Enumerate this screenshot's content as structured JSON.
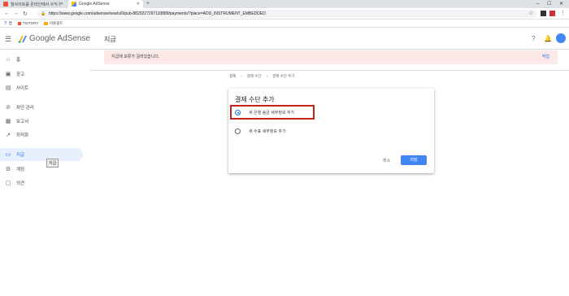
{
  "browser": {
    "tabs": [
      {
        "title": "월사이트를 온라인에서 수익 찬",
        "active": false
      },
      {
        "title": "Google AdSense",
        "active": true
      }
    ],
    "url": "https://www.google.com/adsense/new/u/0/pub-8820227297110889/payments/?place=ADD_INSTRUMENT_EMBEDDED",
    "bookmarks": [
      "앱",
      "TISTORY",
      "이튜링드"
    ]
  },
  "app": {
    "brand": "Google AdSense",
    "page_title": "지급"
  },
  "sidebar": {
    "items": [
      {
        "label": "홈",
        "icon": "home-icon"
      },
      {
        "label": "광고",
        "icon": "ads-icon"
      },
      {
        "label": "사이트",
        "icon": "sites-icon"
      },
      {
        "label": "차단 관리",
        "icon": "block-icon"
      },
      {
        "label": "보고서",
        "icon": "reports-icon"
      },
      {
        "label": "최적화",
        "icon": "optimize-icon"
      },
      {
        "label": "지급",
        "icon": "payments-icon"
      },
      {
        "label": "계정",
        "icon": "account-icon"
      },
      {
        "label": "의견",
        "icon": "feedback-icon"
      }
    ],
    "tooltip": "지급"
  },
  "banner": {
    "text": "지급에 보류가 걸려있습니다.",
    "action": "작업"
  },
  "breadcrumbs": [
    "결제",
    "결제 수단",
    "결제 수단 추가"
  ],
  "card": {
    "title": "결제 수단 추가",
    "options": [
      {
        "label": "새 은행 송금 세부정보 추가",
        "selected": true
      },
      {
        "label": "새 수표 세부정보 추가",
        "selected": false
      }
    ],
    "cancel": "취소",
    "save": "저장"
  }
}
